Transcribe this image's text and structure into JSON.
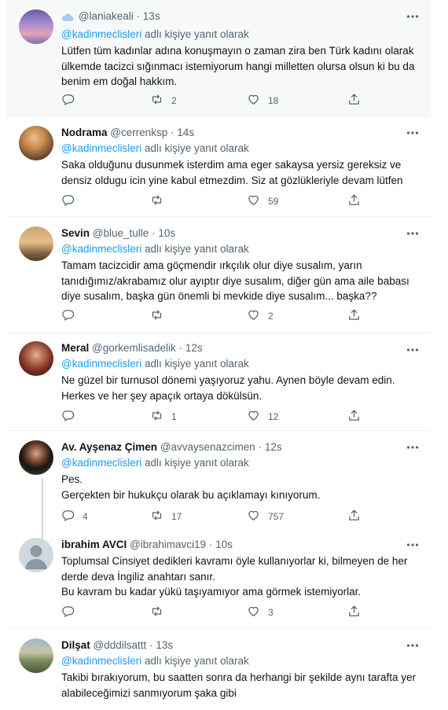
{
  "reply_prefix": "adlı kişiye yanıt olarak",
  "colors": {
    "link": "#1d9bf0",
    "muted": "#536471",
    "text": "#0f1419",
    "highlight_bg": "#f7f9f9"
  },
  "tweets": [
    {
      "name": "",
      "handle": "@laniakeali",
      "time": "13s",
      "mention": "@kadinmeclisleri",
      "lines": [
        "Lütfen tüm kadınlar adına konuşmayın o zaman zira ben Türk kadını olarak",
        "ülkemde tacizci sığınmacı istemiyorum hangi milletten olursa olsun ki bu da",
        "benim em doğal hakkım."
      ],
      "counts": {
        "reply": "",
        "retweet": "2",
        "like": "18"
      }
    },
    {
      "name": "Nodrama",
      "handle": "@cerrenksp",
      "time": "14s",
      "mention": "@kadinmeclisleri",
      "lines": [
        "Saka olduğunu dusunmek isterdim ama eger sakaysa yersiz gereksiz ve",
        "densiz oldugu icin yine kabul etmezdim. Siz at gözlükleriyle devam lütfen"
      ],
      "counts": {
        "reply": "",
        "retweet": "",
        "like": "59"
      }
    },
    {
      "name": "Sevin",
      "handle": "@blue_tulle",
      "time": "10s",
      "mention": "@kadinmeclisleri",
      "lines": [
        "Tamam tacizcidir ama göçmendir ırkçılık olur diye susalım, yarın",
        "tanıdığımız/akrabamız olur ayıptır diye susalım, diğer gün ama aile babası",
        "diye susalım, başka gün önemli bi mevkide diye susalım... başka??"
      ],
      "counts": {
        "reply": "",
        "retweet": "",
        "like": "2"
      }
    },
    {
      "name": "Meral",
      "handle": "@gorkemlisadelik",
      "time": "12s",
      "mention": "@kadinmeclisleri",
      "lines": [
        "Ne güzel bir turnusol dönemi yaşıyoruz yahu. Aynen böyle devam edin.",
        "Herkes ve her şey apaçık ortaya dökülsün."
      ],
      "counts": {
        "reply": "",
        "retweet": "1",
        "like": "12"
      }
    },
    {
      "name": "Av. Ayşenaz Çimen",
      "handle": "@avvaysenazcimen",
      "time": "12s",
      "mention": "@kadinmeclisleri",
      "lines": [
        "Pes.",
        "Gerçekten bir hukukçu olarak bu açıklamayı kınıyorum."
      ],
      "counts": {
        "reply": "4",
        "retweet": "17",
        "like": "757"
      }
    },
    {
      "name": "ibrahim AVCI",
      "handle": "@ibrahimavci19",
      "time": "10s",
      "mention": "",
      "lines": [
        "Toplumsal Cinsiyet dedikleri kavramı öyle kullanıyorlar ki, bilmeyen de her",
        "derde deva İngiliz anahtarı sanır.",
        "Bu kavram bu kadar yükü taşıyamıyor ama görmek istemiyorlar."
      ],
      "counts": {
        "reply": "",
        "retweet": "",
        "like": "3"
      }
    },
    {
      "name": "Dilşat",
      "handle": "@dddilsattt",
      "time": "13s",
      "mention": "@kadinmeclisleri",
      "lines": [
        "Takibi bırakıyorum, bu saatten sonra da herhangi bir şekilde aynı tarafta yer",
        "alabileceğimizi sanmıyorum şaka gibi"
      ],
      "counts": {
        "reply": "",
        "retweet": "",
        "like": ""
      }
    }
  ]
}
